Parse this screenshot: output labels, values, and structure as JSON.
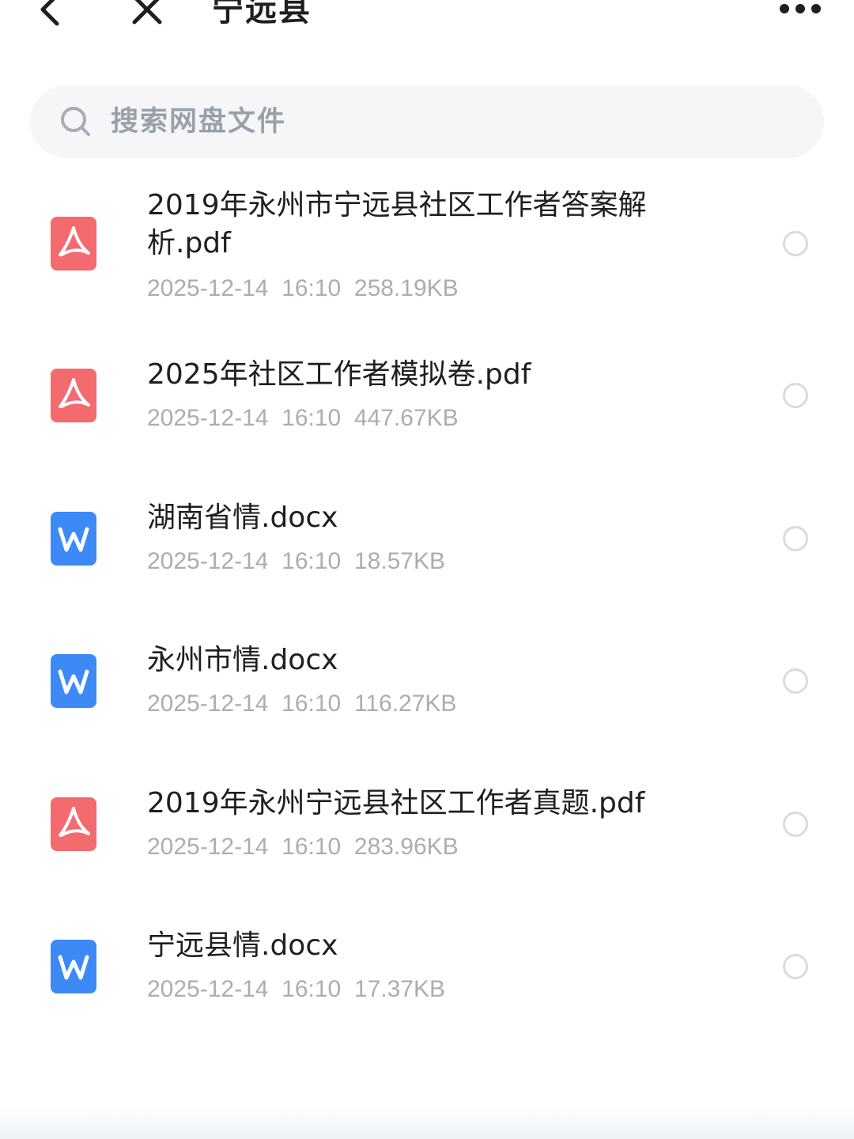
{
  "header": {
    "title": "宁远县",
    "back_icon": "chevron-left-icon",
    "close_icon": "close-icon",
    "more_icon": "more-horizontal-icon"
  },
  "search": {
    "placeholder": "搜索网盘文件",
    "icon": "search-icon"
  },
  "colors": {
    "pdf": "#f36a6f",
    "docx": "#3d8af7",
    "meta_text": "#a9adb4",
    "search_bg": "#f5f6f8"
  },
  "files": [
    {
      "type": "pdf",
      "icon": "pdf-file-icon",
      "name": "2019年永州市宁远县社区工作者答案解析.pdf",
      "date": "2025-12-14",
      "time": "16:10",
      "size": "258.19KB"
    },
    {
      "type": "pdf",
      "icon": "pdf-file-icon",
      "name": "2025年社区工作者模拟卷.pdf",
      "date": "2025-12-14",
      "time": "16:10",
      "size": "447.67KB"
    },
    {
      "type": "docx",
      "icon": "word-file-icon",
      "name": "湖南省情.docx",
      "date": "2025-12-14",
      "time": "16:10",
      "size": "18.57KB"
    },
    {
      "type": "docx",
      "icon": "word-file-icon",
      "name": "永州市情.docx",
      "date": "2025-12-14",
      "time": "16:10",
      "size": "116.27KB"
    },
    {
      "type": "pdf",
      "icon": "pdf-file-icon",
      "name": "2019年永州宁远县社区工作者真题.pdf",
      "date": "2025-12-14",
      "time": "16:10",
      "size": "283.96KB"
    },
    {
      "type": "docx",
      "icon": "word-file-icon",
      "name": "宁远县情.docx",
      "date": "2025-12-14",
      "time": "16:10",
      "size": "17.37KB"
    }
  ]
}
